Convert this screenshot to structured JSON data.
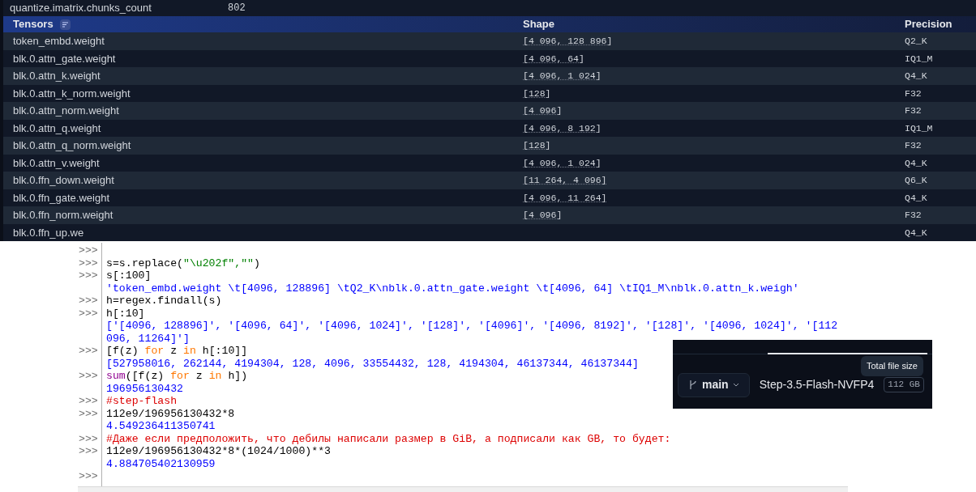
{
  "metadata_row": {
    "key": "quantize.imatrix.chunks_count",
    "value": "802"
  },
  "tensors_table": {
    "columns": [
      "Tensors",
      "Shape",
      "Precision"
    ],
    "rows": [
      {
        "name": "token_embd.weight",
        "shape": "[4 096, 128 896]",
        "precision": "Q2_K"
      },
      {
        "name": "blk.0.attn_gate.weight",
        "shape": "[4 096, 64]",
        "precision": "IQ1_M"
      },
      {
        "name": "blk.0.attn_k.weight",
        "shape": "[4 096, 1 024]",
        "precision": "Q4_K"
      },
      {
        "name": "blk.0.attn_k_norm.weight",
        "shape": "[128]",
        "precision": "F32"
      },
      {
        "name": "blk.0.attn_norm.weight",
        "shape": "[4 096]",
        "precision": "F32"
      },
      {
        "name": "blk.0.attn_q.weight",
        "shape": "[4 096, 8 192]",
        "precision": "IQ1_M"
      },
      {
        "name": "blk.0.attn_q_norm.weight",
        "shape": "[128]",
        "precision": "F32"
      },
      {
        "name": "blk.0.attn_v.weight",
        "shape": "[4 096, 1 024]",
        "precision": "Q4_K"
      },
      {
        "name": "blk.0.ffn_down.weight",
        "shape": "[11 264, 4 096]",
        "precision": "Q6_K"
      },
      {
        "name": "blk.0.ffn_gate.weight",
        "shape": "[4 096, 11 264]",
        "precision": "Q4_K"
      },
      {
        "name": "blk.0.ffn_norm.weight",
        "shape": "[4 096]",
        "precision": "F32"
      },
      {
        "name": "blk.0.ffn_up.we",
        "precision": "Q4_K"
      }
    ]
  },
  "python_shell": {
    "lines": [
      {
        "prompt": ">>>"
      },
      {
        "prompt": ">>>",
        "segments": [
          {
            "kind": "code",
            "text": "s=s.replace("
          },
          {
            "kind": "string",
            "text": "\"\\u202f\",\"\""
          },
          {
            "kind": "code",
            "text": ")"
          }
        ]
      },
      {
        "prompt": ">>>",
        "segments": [
          {
            "kind": "code",
            "text": "s[:100]"
          }
        ]
      },
      {
        "segments": [
          {
            "kind": "output",
            "text": "'token_embd.weight \\t[4096, 128896] \\tQ2_K\\nblk.0.attn_gate.weight \\t[4096, 64] \\tIQ1_M\\nblk.0.attn_k.weigh'"
          }
        ]
      },
      {
        "prompt": ">>>",
        "segments": [
          {
            "kind": "code",
            "text": "h=regex.findall(s)"
          }
        ]
      },
      {
        "prompt": ">>>",
        "segments": [
          {
            "kind": "code",
            "text": "h[:10]"
          }
        ]
      },
      {
        "segments": [
          {
            "kind": "output",
            "text": "['[4096, 128896]', '[4096, 64]', '[4096, 1024]', '[128]', '[4096]', '[4096, 8192]', '[128]', '[4096, 1024]', '[112"
          }
        ]
      },
      {
        "segments": [
          {
            "kind": "output",
            "text": "096, 11264]']"
          }
        ]
      },
      {
        "prompt": ">>>",
        "segments": [
          {
            "kind": "code",
            "text": "[f(z) "
          },
          {
            "kind": "keyword",
            "text": "for"
          },
          {
            "kind": "code",
            "text": " z "
          },
          {
            "kind": "keyword",
            "text": "in"
          },
          {
            "kind": "code",
            "text": " h[:10]]"
          }
        ]
      },
      {
        "segments": [
          {
            "kind": "output",
            "text": "[527958016, 262144, 4194304, 128, 4096, 33554432, 128, 4194304, 46137344, 46137344]"
          }
        ]
      },
      {
        "prompt": ">>>",
        "segments": [
          {
            "kind": "builtin",
            "text": "sum"
          },
          {
            "kind": "code",
            "text": "([f(z) "
          },
          {
            "kind": "keyword",
            "text": "for"
          },
          {
            "kind": "code",
            "text": " z "
          },
          {
            "kind": "keyword",
            "text": "in"
          },
          {
            "kind": "code",
            "text": " h])"
          }
        ]
      },
      {
        "segments": [
          {
            "kind": "output",
            "text": "196956130432"
          }
        ]
      },
      {
        "prompt": ">>>",
        "segments": [
          {
            "kind": "comment",
            "text": "#step-flash"
          }
        ]
      },
      {
        "prompt": ">>>",
        "segments": [
          {
            "kind": "code",
            "text": "112e9/196956130432*8"
          }
        ]
      },
      {
        "segments": [
          {
            "kind": "output",
            "text": "4.549236411350741"
          }
        ]
      },
      {
        "prompt": ">>>",
        "segments": [
          {
            "kind": "comment",
            "text": "#Даже если предположить, что дебилы написали размер в GiB, а подписали как GB, то будет:"
          }
        ]
      },
      {
        "prompt": ">>>",
        "segments": [
          {
            "kind": "code",
            "text": "112e9/196956130432*8*(1024/1000)**3"
          }
        ]
      },
      {
        "segments": [
          {
            "kind": "output",
            "text": "4.884705402130959"
          }
        ]
      },
      {
        "prompt": ">>>"
      }
    ]
  },
  "hf_panel": {
    "tooltip": "Total file size",
    "branch": "main",
    "repo_name": "Step-3.5-Flash-NVFP4",
    "size_badge": "112 GB"
  }
}
